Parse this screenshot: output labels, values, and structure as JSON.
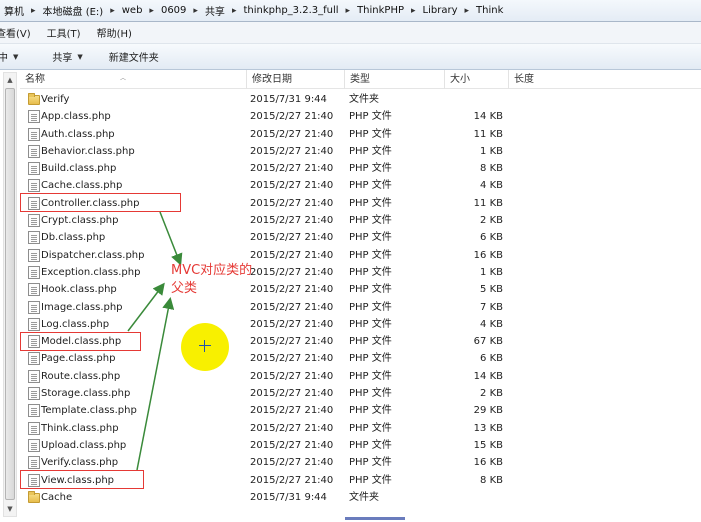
{
  "breadcrumbs": [
    "算机",
    "本地磁盘 (E:)",
    "web",
    "0609",
    "共享",
    "thinkphp_3.2.3_full",
    "ThinkPHP",
    "Library",
    "Think"
  ],
  "breadcrumb_separator": "▸",
  "menu": [
    "查看(V)",
    "工具(T)",
    "帮助(H)"
  ],
  "toolbar": {
    "organize_label": "中",
    "share_label": "共享",
    "new_folder_label": "新建文件夹",
    "caret": "▼"
  },
  "columns": {
    "name": "名称",
    "date": "修改日期",
    "type": "类型",
    "size": "大小",
    "length": "长度"
  },
  "files": [
    {
      "name": "Verify",
      "date": "2015/7/31 9:44",
      "type": "文件夹",
      "size": "",
      "icon": "folder-icon"
    },
    {
      "name": "App.class.php",
      "date": "2015/2/27 21:40",
      "type": "PHP 文件",
      "size": "14 KB",
      "icon": "php-file-icon"
    },
    {
      "name": "Auth.class.php",
      "date": "2015/2/27 21:40",
      "type": "PHP 文件",
      "size": "11 KB",
      "icon": "php-file-icon"
    },
    {
      "name": "Behavior.class.php",
      "date": "2015/2/27 21:40",
      "type": "PHP 文件",
      "size": "1 KB",
      "icon": "php-file-icon"
    },
    {
      "name": "Build.class.php",
      "date": "2015/2/27 21:40",
      "type": "PHP 文件",
      "size": "8 KB",
      "icon": "php-file-icon"
    },
    {
      "name": "Cache.class.php",
      "date": "2015/2/27 21:40",
      "type": "PHP 文件",
      "size": "4 KB",
      "icon": "php-file-icon"
    },
    {
      "name": "Controller.class.php",
      "date": "2015/2/27 21:40",
      "type": "PHP 文件",
      "size": "11 KB",
      "icon": "php-file-icon"
    },
    {
      "name": "Crypt.class.php",
      "date": "2015/2/27 21:40",
      "type": "PHP 文件",
      "size": "2 KB",
      "icon": "php-file-icon"
    },
    {
      "name": "Db.class.php",
      "date": "2015/2/27 21:40",
      "type": "PHP 文件",
      "size": "6 KB",
      "icon": "php-file-icon"
    },
    {
      "name": "Dispatcher.class.php",
      "date": "2015/2/27 21:40",
      "type": "PHP 文件",
      "size": "16 KB",
      "icon": "php-file-icon"
    },
    {
      "name": "Exception.class.php",
      "date": "2015/2/27 21:40",
      "type": "PHP 文件",
      "size": "1 KB",
      "icon": "php-file-icon"
    },
    {
      "name": "Hook.class.php",
      "date": "2015/2/27 21:40",
      "type": "PHP 文件",
      "size": "5 KB",
      "icon": "php-file-icon"
    },
    {
      "name": "Image.class.php",
      "date": "2015/2/27 21:40",
      "type": "PHP 文件",
      "size": "7 KB",
      "icon": "php-file-icon"
    },
    {
      "name": "Log.class.php",
      "date": "2015/2/27 21:40",
      "type": "PHP 文件",
      "size": "4 KB",
      "icon": "php-file-icon"
    },
    {
      "name": "Model.class.php",
      "date": "2015/2/27 21:40",
      "type": "PHP 文件",
      "size": "67 KB",
      "icon": "php-file-icon"
    },
    {
      "name": "Page.class.php",
      "date": "2015/2/27 21:40",
      "type": "PHP 文件",
      "size": "6 KB",
      "icon": "php-file-icon"
    },
    {
      "name": "Route.class.php",
      "date": "2015/2/27 21:40",
      "type": "PHP 文件",
      "size": "14 KB",
      "icon": "php-file-icon"
    },
    {
      "name": "Storage.class.php",
      "date": "2015/2/27 21:40",
      "type": "PHP 文件",
      "size": "2 KB",
      "icon": "php-file-icon"
    },
    {
      "name": "Template.class.php",
      "date": "2015/2/27 21:40",
      "type": "PHP 文件",
      "size": "29 KB",
      "icon": "php-file-icon"
    },
    {
      "name": "Think.class.php",
      "date": "2015/2/27 21:40",
      "type": "PHP 文件",
      "size": "13 KB",
      "icon": "php-file-icon"
    },
    {
      "name": "Upload.class.php",
      "date": "2015/2/27 21:40",
      "type": "PHP 文件",
      "size": "15 KB",
      "icon": "php-file-icon"
    },
    {
      "name": "Verify.class.php",
      "date": "2015/2/27 21:40",
      "type": "PHP 文件",
      "size": "16 KB",
      "icon": "php-file-icon"
    },
    {
      "name": "View.class.php",
      "date": "2015/2/27 21:40",
      "type": "PHP 文件",
      "size": "8 KB",
      "icon": "php-file-icon"
    },
    {
      "name": "Cache",
      "date": "2015/7/31 9:44",
      "type": "文件夹",
      "size": "",
      "icon": "folder-icon"
    }
  ],
  "annotation": {
    "line1": "MVC对应类的",
    "line2": "父类",
    "color": "#e53935",
    "arrow_color": "#3a8a3a"
  },
  "scrollbar": {
    "up": "▲",
    "down": "▼"
  },
  "colors": {
    "highlight": "#f8f000",
    "header_bg": "#e4ecf5"
  }
}
